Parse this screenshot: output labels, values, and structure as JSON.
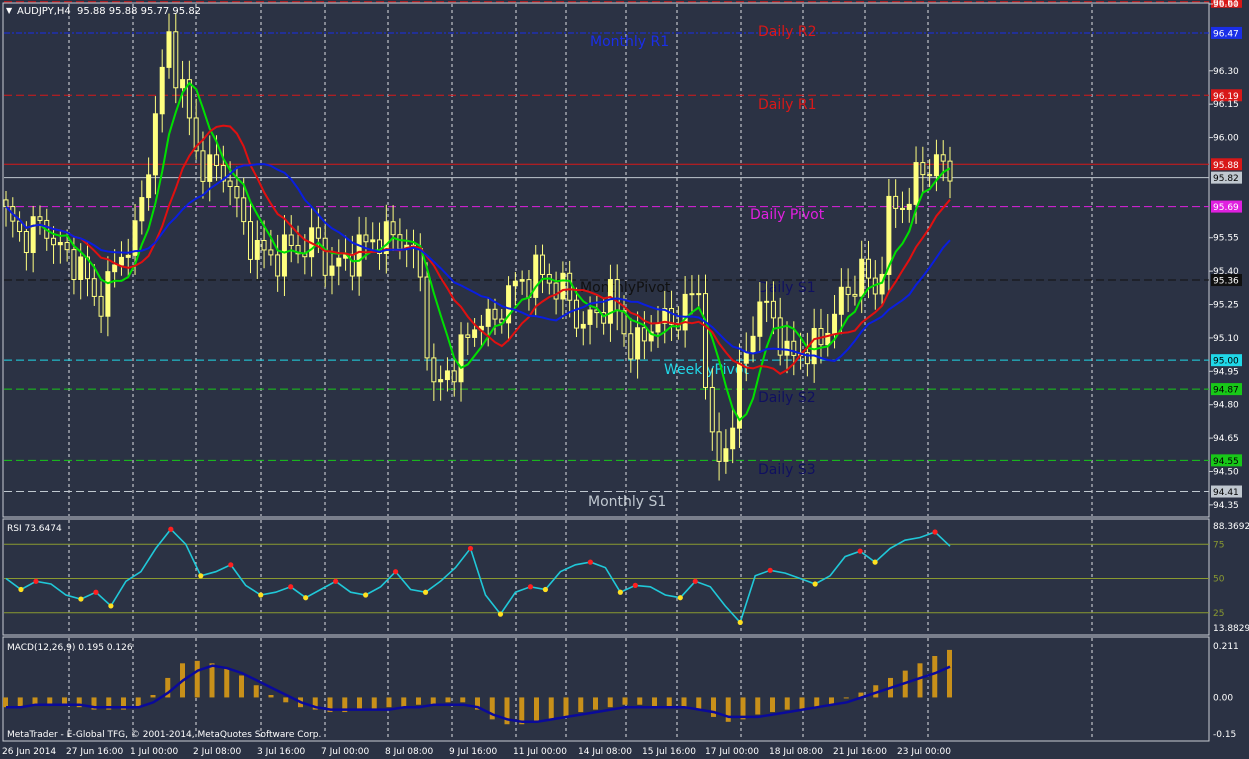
{
  "header": {
    "symbol": "AUDJPY,H4",
    "ohlc": "95.88 95.88 95.77 95.82"
  },
  "footer": {
    "copyright": "MetaTrader - E-Global TFG, © 2001-2014, MetaQuotes Software Corp."
  },
  "colors": {
    "background": "#2b3244",
    "grid": "#ffffff",
    "bull": "#ffff80",
    "bear": "#ffff80",
    "ma_fast": "#00e000",
    "ma_mid": "#e01010",
    "ma_slow": "#0a1ee0",
    "rsi": "#20c8d8",
    "macd_hist": "#c8901a",
    "macd_signal": "#0a0a9a"
  },
  "chart_data": [
    {
      "type": "candlestick",
      "title": "AUDJPY,H4",
      "ylim": [
        94.3,
        96.6
      ],
      "y_ticks": [
        "96.60",
        "96.30",
        "96.15",
        "96.00",
        "95.55",
        "95.40",
        "95.25",
        "95.10",
        "94.95",
        "94.80",
        "94.65",
        "94.50",
        "94.35"
      ],
      "x_tick_labels": [
        "26 Jun 2014",
        "27 Jun 16:00",
        "1 Jul 00:00",
        "2 Jul 08:00",
        "3 Jul 16:00",
        "7 Jul 00:00",
        "8 Jul 08:00",
        "9 Jul 16:00",
        "11 Jul 00:00",
        "14 Jul 08:00",
        "15 Jul 16:00",
        "17 Jul 00:00",
        "18 Jul 08:00",
        "21 Jul 16:00",
        "23 Jul 00:00"
      ],
      "close_anchors": [
        95.65,
        95.55,
        95.6,
        95.58,
        95.45,
        95.45,
        95.25,
        95.35,
        95.5,
        95.6,
        96.05,
        96.45,
        96.2,
        95.9,
        95.85,
        95.85,
        95.6,
        95.5,
        95.45,
        95.5,
        95.5,
        95.55,
        95.4,
        95.45,
        95.5,
        95.55,
        95.55,
        95.55,
        95.4,
        94.85,
        94.95,
        95.05,
        95.2,
        95.15,
        95.3,
        95.35,
        95.4,
        95.35,
        95.3,
        95.15,
        95.2,
        95.3,
        95.1,
        95.05,
        95.2,
        95.15,
        95.25,
        95.3,
        94.5,
        94.65,
        95.0,
        95.25,
        95.2,
        95.0,
        95.05,
        95.05,
        95.2,
        95.3,
        95.4,
        95.3,
        95.7,
        95.7,
        95.85,
        95.9,
        95.82
      ],
      "horizontal_levels": [
        {
          "name": "Daily R2",
          "value": 96.61,
          "label": "96.61",
          "color": "#d81818"
        },
        {
          "name": "Monthly R1",
          "value": 96.47,
          "label": "96.47",
          "color": "#1a2ee8"
        },
        {
          "name": "Daily R1",
          "value": 96.19,
          "label": "96.19",
          "color": "#d81818"
        },
        {
          "name": "",
          "value": 95.88,
          "label": "95.88",
          "color": "#d81818"
        },
        {
          "name": "",
          "value": 95.82,
          "label": "95.82",
          "color": "#c0c8d0"
        },
        {
          "name": "Daily Pivot",
          "value": 95.69,
          "label": "95.69",
          "color": "#e020e0"
        },
        {
          "name": "Daily S1",
          "value": 95.36,
          "label": "95.36",
          "color": "#101010"
        },
        {
          "name": "WeeklyPivot",
          "value": 95.0,
          "label": "95.00",
          "color": "#20d8e8"
        },
        {
          "name": "Daily S2",
          "value": 94.87,
          "label": "94.87",
          "color": "#18c818"
        },
        {
          "name": "Daily S3",
          "value": 94.55,
          "label": "94.55",
          "color": "#18c818"
        },
        {
          "name": "Monthly S1",
          "value": 94.41,
          "label": "94.41",
          "color": "#c0c8d0"
        }
      ],
      "level_labels": [
        {
          "text": "Daily R2",
          "color": "#d81818"
        },
        {
          "text": "Monthly R1",
          "color": "#1a2ee8"
        },
        {
          "text": "Daily R1",
          "color": "#d81818"
        },
        {
          "text": "Daily Pivot",
          "color": "#e020e0"
        },
        {
          "text": "Daily S1",
          "color": "#101060"
        },
        {
          "text": "MonthlyPivot",
          "color": "#101010"
        },
        {
          "text": "WeeklyPivot",
          "color": "#20d8e8"
        },
        {
          "text": "Daily S2",
          "color": "#101060"
        },
        {
          "text": "Daily S3",
          "color": "#101060"
        },
        {
          "text": "Monthly S1",
          "color": "#c0c8d0"
        }
      ]
    },
    {
      "type": "line",
      "title": "RSI 73.6474",
      "ylim": [
        13.8829,
        88.3692
      ],
      "y_ticks": [
        "88.3692",
        "75",
        "50",
        "25",
        "13.8829"
      ],
      "levels": [
        75,
        50,
        25
      ],
      "values": [
        50,
        42,
        48,
        46,
        38,
        35,
        40,
        30,
        48,
        55,
        72,
        86,
        75,
        52,
        55,
        60,
        45,
        38,
        40,
        44,
        36,
        42,
        48,
        40,
        38,
        44,
        55,
        42,
        40,
        48,
        58,
        72,
        38,
        24,
        40,
        44,
        42,
        55,
        60,
        62,
        58,
        40,
        45,
        44,
        38,
        36,
        48,
        44,
        30,
        18,
        52,
        56,
        54,
        50,
        46,
        52,
        66,
        70,
        62,
        72,
        78,
        80,
        84,
        73.6474
      ]
    },
    {
      "type": "bar",
      "title": "MACD(12,26,9) 0.195 0.126",
      "ylim": [
        -0.15,
        0.211
      ],
      "y_ticks": [
        "0.211",
        "0.00",
        "-0.15"
      ],
      "histogram": [
        -0.04,
        -0.04,
        -0.03,
        -0.03,
        -0.03,
        -0.04,
        -0.05,
        -0.05,
        -0.05,
        -0.04,
        0.01,
        0.08,
        0.14,
        0.15,
        0.14,
        0.12,
        0.09,
        0.05,
        0.01,
        -0.02,
        -0.04,
        -0.05,
        -0.06,
        -0.06,
        -0.05,
        -0.05,
        -0.04,
        -0.04,
        -0.03,
        -0.03,
        -0.02,
        -0.02,
        -0.05,
        -0.09,
        -0.11,
        -0.11,
        -0.1,
        -0.09,
        -0.08,
        -0.06,
        -0.05,
        -0.04,
        -0.03,
        -0.03,
        -0.04,
        -0.04,
        -0.04,
        -0.05,
        -0.08,
        -0.1,
        -0.09,
        -0.07,
        -0.06,
        -0.05,
        -0.05,
        -0.04,
        -0.03,
        0.0,
        0.02,
        0.05,
        0.08,
        0.11,
        0.14,
        0.17,
        0.195
      ],
      "signal": [
        -0.04,
        -0.04,
        -0.03,
        -0.03,
        -0.03,
        -0.03,
        -0.04,
        -0.04,
        -0.04,
        -0.04,
        -0.02,
        0.02,
        0.07,
        0.11,
        0.13,
        0.12,
        0.1,
        0.07,
        0.04,
        0.01,
        -0.02,
        -0.04,
        -0.05,
        -0.05,
        -0.05,
        -0.05,
        -0.05,
        -0.04,
        -0.04,
        -0.03,
        -0.03,
        -0.03,
        -0.04,
        -0.07,
        -0.09,
        -0.1,
        -0.1,
        -0.09,
        -0.08,
        -0.07,
        -0.06,
        -0.05,
        -0.04,
        -0.04,
        -0.04,
        -0.04,
        -0.04,
        -0.05,
        -0.06,
        -0.08,
        -0.08,
        -0.08,
        -0.07,
        -0.06,
        -0.05,
        -0.04,
        -0.03,
        -0.02,
        0.0,
        0.02,
        0.04,
        0.06,
        0.08,
        0.1,
        0.126
      ]
    }
  ]
}
